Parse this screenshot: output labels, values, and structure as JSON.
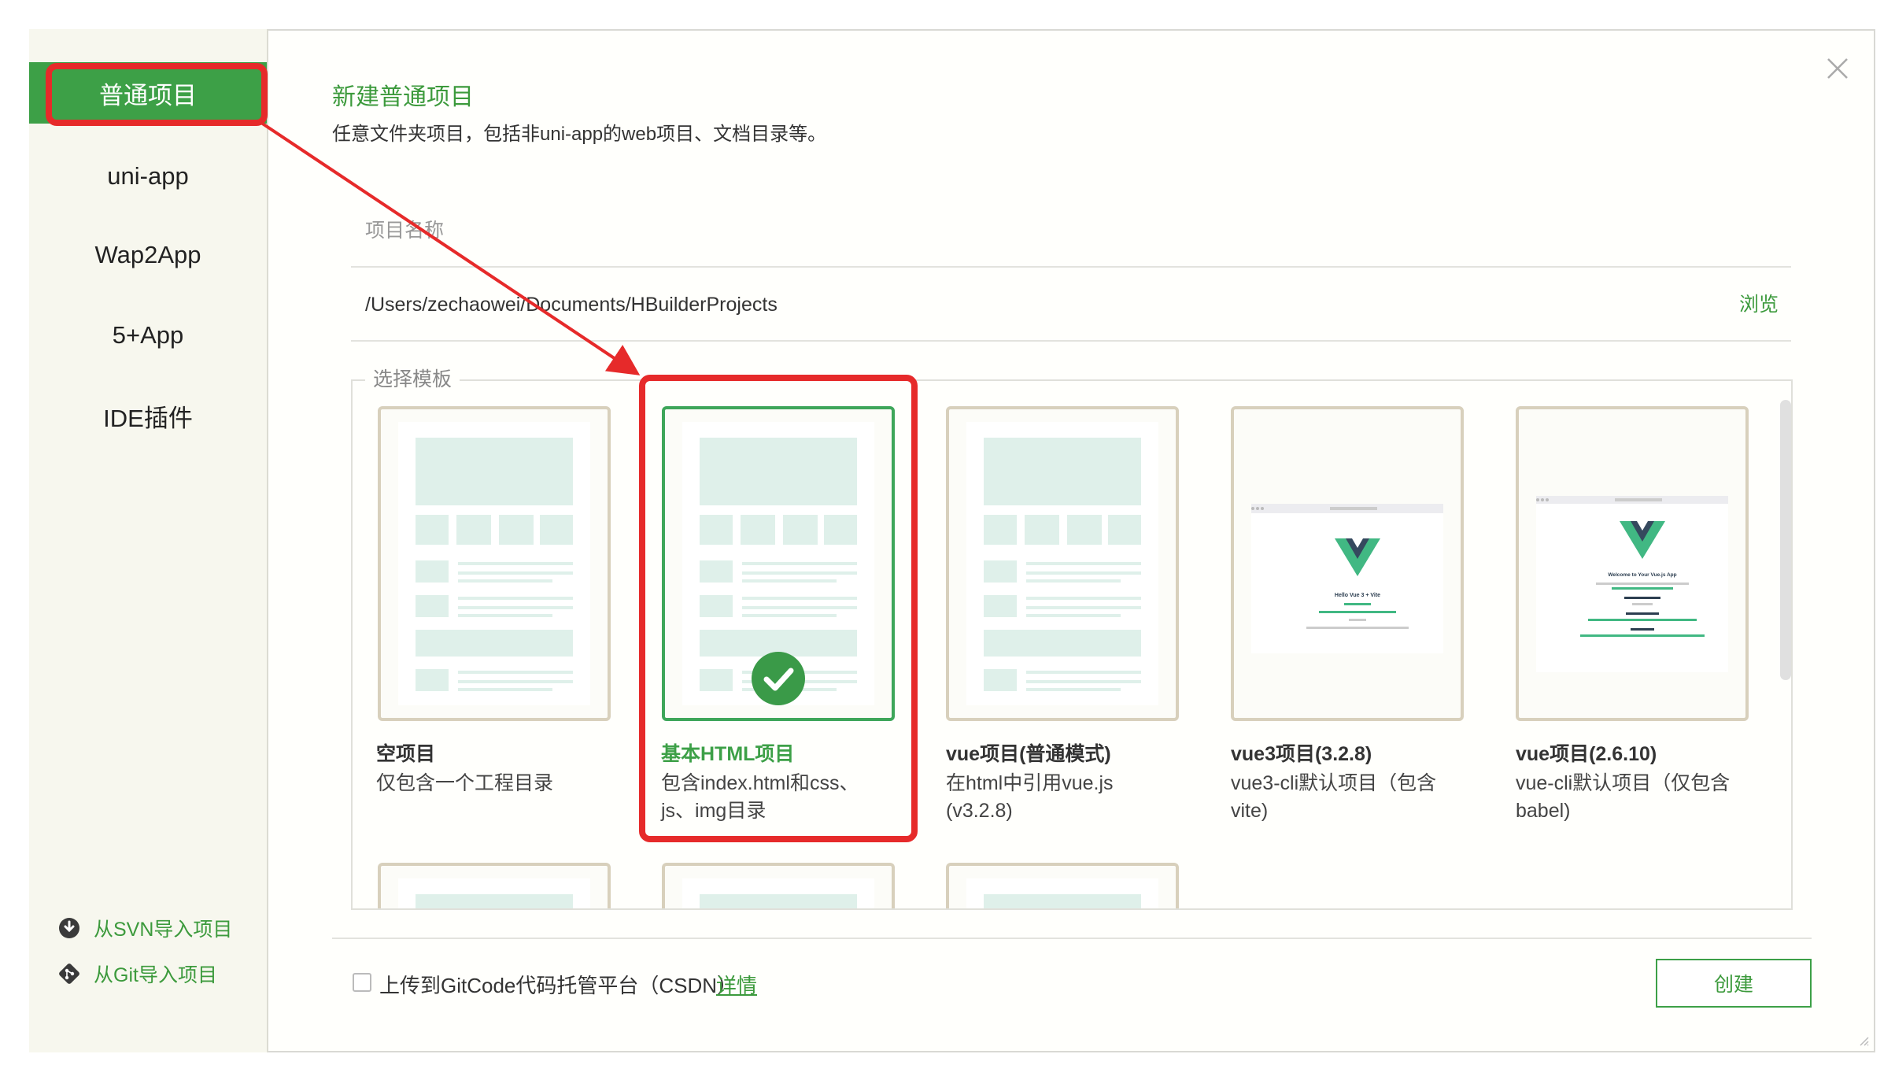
{
  "sidebar": {
    "items": [
      {
        "label": "普通项目",
        "active": true
      },
      {
        "label": "uni-app"
      },
      {
        "label": "Wap2App"
      },
      {
        "label": "5+App"
      },
      {
        "label": "IDE插件"
      }
    ],
    "imports": [
      {
        "label": "从SVN导入项目",
        "icon": "svn-icon"
      },
      {
        "label": "从Git导入项目",
        "icon": "git-icon"
      }
    ]
  },
  "main": {
    "title": "新建普通项目",
    "subtitle": "任意文件夹项目，包括非uni-app的web项目、文档目录等。",
    "project_name": {
      "placeholder": "项目名称",
      "value": ""
    },
    "project_path": {
      "value": "/Users/zechaowei/Documents/HBuilderProjects"
    },
    "browse_label": "浏览",
    "template_legend": "选择模板",
    "templates": [
      {
        "title": "空项目",
        "desc": "仅包含一个工程目录",
        "selected": false
      },
      {
        "title": "基本HTML项目",
        "desc": "包含index.html和css、js、img目录",
        "selected": true
      },
      {
        "title": "vue项目(普通模式)",
        "desc": "在html中引用vue.js (v3.2.8)",
        "selected": false
      },
      {
        "title": "vue3项目(3.2.8)",
        "desc": "vue3-cli默认项目（包含vite)",
        "selected": false,
        "preview": {
          "heading": "Hello Vue 3 + Vite"
        }
      },
      {
        "title": "vue项目(2.6.10)",
        "desc": "vue-cli默认项目（仅包含babel)",
        "selected": false,
        "preview": {
          "heading": "Welcome to Your Vue.js App"
        }
      }
    ]
  },
  "footer": {
    "upload_label": "上传到GitCode代码托管平台（CSDN）",
    "upload_checked": false,
    "details_label": "详情",
    "create_label": "创建"
  },
  "colors": {
    "accent": "#3da047",
    "highlight": "#e62a2a",
    "sidebar_bg": "#f7f7ee",
    "card_border": "#d8d0bc",
    "skeleton": "#dff0ea"
  }
}
